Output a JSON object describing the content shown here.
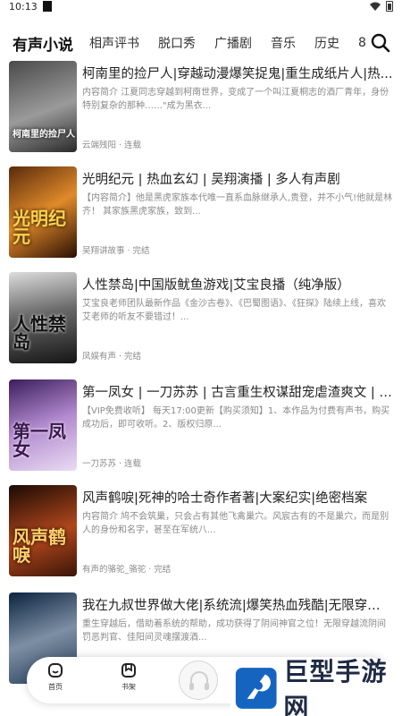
{
  "status_bar": {
    "time": "10:13"
  },
  "tabs": [
    {
      "label": "有声小说",
      "active": true
    },
    {
      "label": "相声评书"
    },
    {
      "label": "脱口秀"
    },
    {
      "label": "广播剧"
    },
    {
      "label": "音乐"
    },
    {
      "label": "历史"
    },
    {
      "label": "8"
    }
  ],
  "books": [
    {
      "title": "柯南里的捡尸人|穿越动漫爆笑捉鬼|重生成纸片人|热...",
      "desc": "内容简介 江夏同志穿越到柯南世界，变成了一个叫江夏桐志的酒厂青年，身份特别复杂的那种……\"成为黑衣...",
      "author": "云端残阳 · 连载",
      "cover_text": "柯南里的捡尸人",
      "cover_colors": [
        "#3a3a3a",
        "#8a8a8a"
      ]
    },
    {
      "title": "光明纪元 | 热血玄幻 | 吴翔演播 | 多人有声剧",
      "desc": "【内容简介】他是黑虎家族本代唯一直系血脉继承人,贵登，并不小气!他就是林齐！ 其家族黑虎家族，致到...",
      "author": "吴翔讲故事 · 完结",
      "cover_text": "光明纪元",
      "cover_colors": [
        "#3b1a08",
        "#d9781f"
      ]
    },
    {
      "title": "人性禁岛|中国版鱿鱼游戏|艾宝良播（纯净版）",
      "desc": "艾宝良老师团队最新作品《金沙古卷》、《巴蜀图语》、《狂探》陆续上线，喜欢艾老师的听友不要错过！...",
      "author": "凤娱有声 · 完结",
      "cover_text": "人性禁岛",
      "cover_colors": [
        "#1e1e1e",
        "#b9b9b9"
      ]
    },
    {
      "title": "第一凤女 | 一刀苏苏 | 古言重生权谋甜宠虐渣爽文 | V...",
      "desc": "【VIP免费收听】 每天17:00更新【购买须知】1、本作品为付费有声书，购买成功后，即可收听。2、版权归原...",
      "author": "一刀苏苏 · 连载",
      "cover_text": "第一凤女",
      "cover_colors": [
        "#6a3a8e",
        "#e8d2f0"
      ]
    },
    {
      "title": "风声鹤唳|死神的哈士奇作者著|大案纪实|绝密档案",
      "desc": "内容简介 鸠不会筑巢，只会占有其他飞禽巢穴。风宸古有的不是巢穴，而是别人的身份和名字，甚至在军统八...",
      "author": "有声的骆驼_骆驼 · 完结",
      "cover_text": "风声鹤唳",
      "cover_colors": [
        "#2a1208",
        "#a8421a"
      ]
    },
    {
      "title": "我在九叔世界做大佬|系统流|爆笑热血残酷|无限穿越|...",
      "desc": "重生穿越后，借助着系统的帮助，成功获得了阴间神官之位！无限穿越流阴间罚恶判官、佳阳间灵魂摆渡酒...",
      "author": "",
      "cover_text": "",
      "cover_colors": [
        "#0e2a4a",
        "#6a7d93"
      ]
    }
  ],
  "bottom_nav": {
    "home_label": "首页",
    "shelf_label": "书架"
  },
  "watermark": {
    "text": "巨型手游网"
  },
  "colors": {
    "accent": "#1565c0",
    "text": "#222222",
    "muted": "#8a8a8a"
  }
}
